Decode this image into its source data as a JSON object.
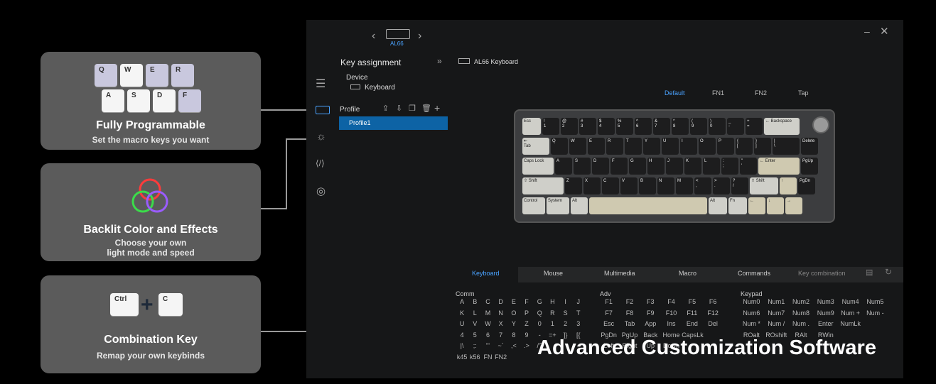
{
  "cards": [
    {
      "title": "Fully Programmable",
      "subtitle": "Set the macro keys you want",
      "keys": [
        "Q",
        "W",
        "E",
        "R",
        "A",
        "S",
        "D",
        "F"
      ]
    },
    {
      "title": "Backlit Color and Effects",
      "subtitle1": "Choose your own",
      "subtitle2": "light mode and speed"
    },
    {
      "title": "Combination Key",
      "subtitle": "Remap your own keybinds",
      "keys": [
        "Ctrl",
        "C"
      ]
    }
  ],
  "app": {
    "device_name": "AL66",
    "panel_title": "Key assignment",
    "device_label": "Device",
    "device_value": "Keyboard",
    "profile_label": "Profile",
    "profile_item": "Profile1",
    "keyboard_name": "AL66 Keyboard",
    "layers": [
      "Default",
      "FN1",
      "FN2",
      "Tap"
    ],
    "bottom_tabs": [
      "Keyboard",
      "Mouse",
      "Multimedia",
      "Macro",
      "Commands",
      "Key combination"
    ],
    "comm_label": "Comm",
    "adv_label": "Adv",
    "keypad_label": "Keypad",
    "comm_keys": [
      "A",
      "B",
      "C",
      "D",
      "E",
      "F",
      "G",
      "H",
      "I",
      "J",
      "K",
      "L",
      "M",
      "N",
      "O",
      "P",
      "Q",
      "R",
      "S",
      "T",
      "U",
      "V",
      "W",
      "X",
      "Y",
      "Z",
      "0",
      "1",
      "2",
      "3",
      "4",
      "5",
      "6",
      "7",
      "8",
      "9",
      "-",
      "=+",
      "]}",
      "[{",
      "|\\",
      ";:",
      "\"'",
      "~`",
      ",<",
      ".>",
      "/?",
      "",
      "",
      "",
      "k45",
      "k56",
      "FN",
      "FN2",
      "",
      "",
      "",
      "",
      "",
      ""
    ],
    "adv_keys": [
      "F1",
      "F2",
      "F3",
      "F4",
      "F5",
      "F6",
      "F7",
      "F8",
      "F9",
      "F10",
      "F11",
      "F12",
      "Esc",
      "Tab",
      "App",
      "Ins",
      "End",
      "Del",
      "PgDn",
      "PgUp",
      "Back",
      "Home",
      "CapsLk",
      "",
      "",
      "",
      "",
      "",
      "",
      "",
      "Left",
      "Right",
      "Up",
      "Down",
      "",
      ""
    ],
    "keypad_keys": [
      "Num0",
      "Num1",
      "Num2",
      "Num3",
      "Num4",
      "Num5",
      "Num6",
      "Num7",
      "Num8",
      "Num9",
      "Num +",
      "Num -",
      "Num *",
      "Num /",
      "Num .",
      "Enter",
      "NumLk",
      "",
      "",
      "",
      "",
      "",
      "",
      "",
      "",
      "",
      "",
      "",
      "",
      "",
      "ROalt",
      "ROshift",
      "RAlt",
      "RWin",
      "",
      ""
    ]
  },
  "keyboard_rows": [
    [
      [
        "Esc",
        "l",
        26
      ],
      [
        "!\n1",
        "d",
        24
      ],
      [
        "@\n2",
        "d",
        24
      ],
      [
        "#\n3",
        "d",
        24
      ],
      [
        "$\n4",
        "d",
        24
      ],
      [
        "%\n5",
        "d",
        24
      ],
      [
        "^\n6",
        "d",
        24
      ],
      [
        "&\n7",
        "d",
        24
      ],
      [
        "*\n8",
        "d",
        24
      ],
      [
        "(\n9",
        "d",
        24
      ],
      [
        ")\n0",
        "d",
        24
      ],
      [
        "_\n-",
        "d",
        24
      ],
      [
        "+\n=",
        "d",
        24
      ],
      [
        "← Backspace",
        "l",
        50
      ]
    ],
    [
      [
        "⇤\nTab",
        "l",
        38
      ],
      [
        "Q",
        "d",
        24
      ],
      [
        "W",
        "d",
        24
      ],
      [
        "E",
        "d",
        24
      ],
      [
        "R",
        "d",
        24
      ],
      [
        "T",
        "d",
        24
      ],
      [
        "Y",
        "d",
        24
      ],
      [
        "U",
        "d",
        24
      ],
      [
        "I",
        "d",
        24
      ],
      [
        "O",
        "d",
        24
      ],
      [
        "P",
        "d",
        24
      ],
      [
        "{\n[",
        "d",
        24
      ],
      [
        "}\n]",
        "d",
        24
      ],
      [
        "|\n\\",
        "d",
        38
      ],
      [
        "Delete",
        "d",
        24
      ]
    ],
    [
      [
        "Caps Lock",
        "l",
        44
      ],
      [
        "A",
        "d",
        24
      ],
      [
        "S",
        "d",
        24
      ],
      [
        "D",
        "d",
        24
      ],
      [
        "F",
        "d",
        24
      ],
      [
        "G",
        "d",
        24
      ],
      [
        "H",
        "d",
        24
      ],
      [
        "J",
        "d",
        24
      ],
      [
        "K",
        "d",
        24
      ],
      [
        "L",
        "d",
        24
      ],
      [
        ":\n;",
        "d",
        24
      ],
      [
        "\"\n'",
        "d",
        24
      ],
      [
        "← Enter",
        "b",
        58
      ],
      [
        "PgUp",
        "d",
        24
      ]
    ],
    [
      [
        "⇧ Shift",
        "l",
        58
      ],
      [
        "Z",
        "d",
        24
      ],
      [
        "X",
        "d",
        24
      ],
      [
        "C",
        "d",
        24
      ],
      [
        "V",
        "d",
        24
      ],
      [
        "B",
        "d",
        24
      ],
      [
        "N",
        "d",
        24
      ],
      [
        "M",
        "d",
        24
      ],
      [
        "<\n,",
        "d",
        24
      ],
      [
        ">\n.",
        "d",
        24
      ],
      [
        "?\n/",
        "d",
        24
      ],
      [
        "⇧ Shift",
        "l",
        40
      ],
      [
        "↑",
        "b",
        24
      ],
      [
        "PgDn",
        "d",
        24
      ]
    ],
    [
      [
        "Control",
        "l",
        32
      ],
      [
        "System",
        "l",
        32
      ],
      [
        "Alt",
        "l",
        24
      ],
      [
        "",
        "b",
        166
      ],
      [
        "Alt",
        "l",
        26
      ],
      [
        "Fn",
        "l",
        26
      ],
      [
        "←",
        "b",
        24
      ],
      [
        "↓",
        "b",
        24
      ],
      [
        "→",
        "b",
        24
      ]
    ]
  ],
  "overlay_text": "Advanced Customization Software"
}
